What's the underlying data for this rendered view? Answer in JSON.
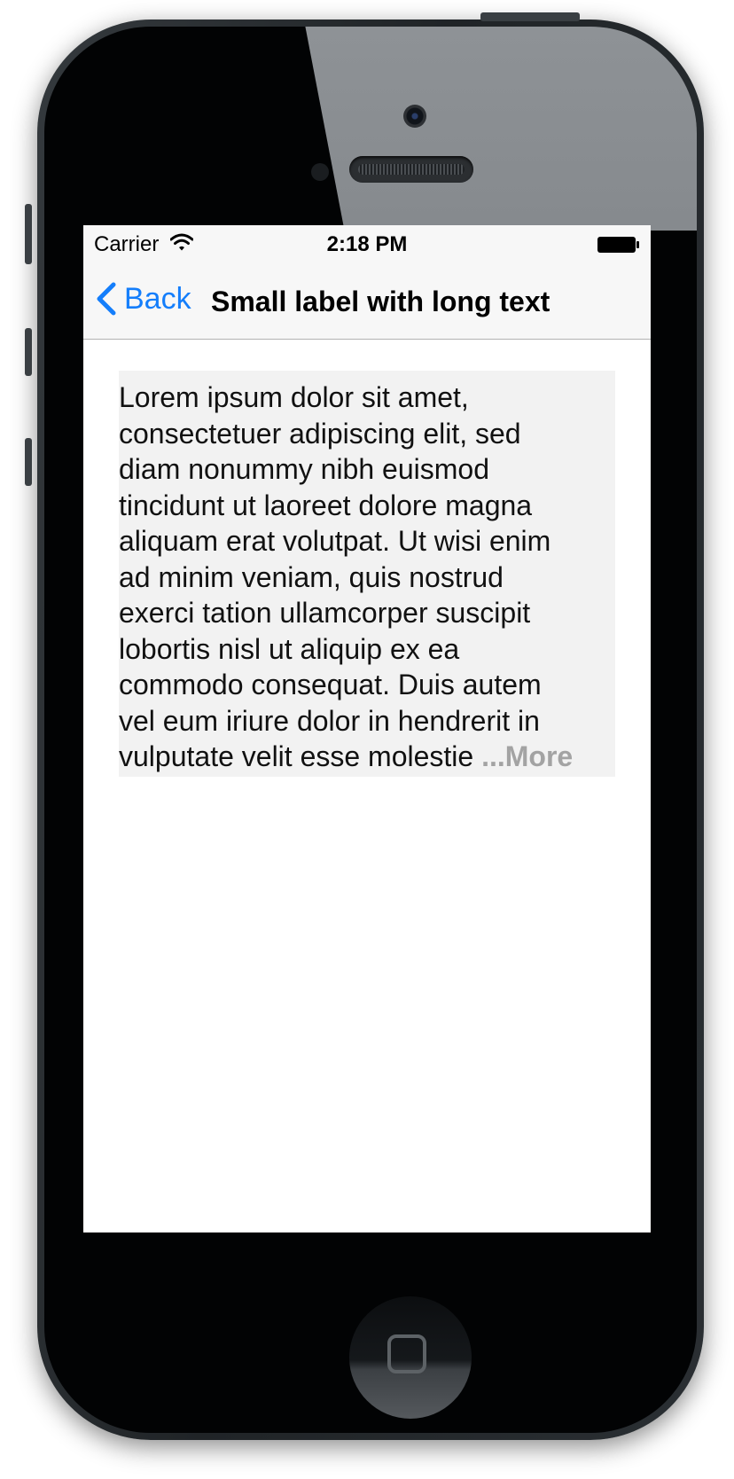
{
  "status_bar": {
    "carrier": "Carrier",
    "time": "2:18 PM",
    "wifi_icon": "wifi-icon",
    "battery_icon": "battery-full-icon"
  },
  "nav_bar": {
    "back_label": "Back",
    "title": "Small label with long text",
    "tint_color": "#147efb"
  },
  "label": {
    "lines": [
      "Lorem ipsum dolor sit amet,",
      "consectetuer adipiscing elit, sed",
      "diam nonummy nibh euismod",
      "tincidunt ut laoreet dolore magna",
      "aliquam erat volutpat. Ut wisi enim",
      "ad minim veniam, quis nostrud",
      "exerci tation ullamcorper suscipit",
      "lobortis nisl ut aliquip ex ea",
      "commodo consequat. Duis autem",
      "vel eum iriure dolor in hendrerit in",
      "vulputate velit esse molestie "
    ],
    "more_label": "...More",
    "background_color": "#f2f2f2",
    "more_color": "#a3a3a3"
  }
}
